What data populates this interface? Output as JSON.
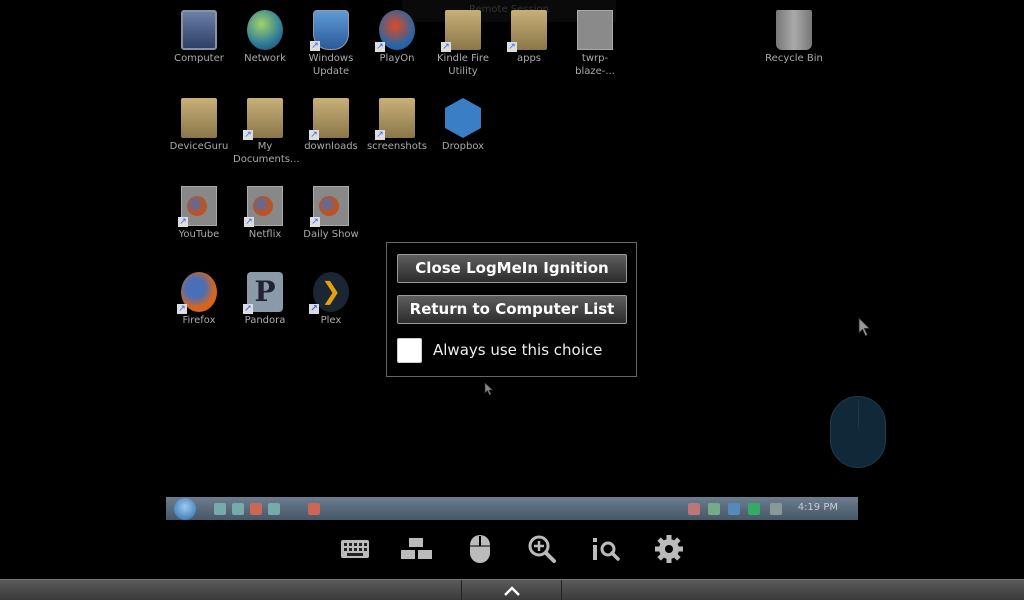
{
  "remote_session_label": "Remote Session",
  "desktop": {
    "icons": [
      {
        "label": "Computer"
      },
      {
        "label": "Network"
      },
      {
        "label": "Windows Update"
      },
      {
        "label": "PlayOn"
      },
      {
        "label": "Kindle Fire Utility"
      },
      {
        "label": "apps"
      },
      {
        "label": "twrp-blaze-..."
      },
      {
        "label": "Recycle Bin"
      },
      {
        "label": "DeviceGuru"
      },
      {
        "label": "My Documents..."
      },
      {
        "label": "downloads"
      },
      {
        "label": "screenshots"
      },
      {
        "label": "Dropbox"
      },
      {
        "label": "YouTube"
      },
      {
        "label": "Netflix"
      },
      {
        "label": "Daily Show"
      },
      {
        "label": "Firefox"
      },
      {
        "label": "Pandora"
      },
      {
        "label": "Plex"
      }
    ],
    "pandora_letter": "P",
    "plex_glyph": "❯"
  },
  "taskbar": {
    "clock": "4:19 PM"
  },
  "dialog": {
    "close_label": "Close LogMeIn Ignition",
    "return_label": "Return to Computer List",
    "always_label": "Always use this choice",
    "always_checked": false
  },
  "toolbar": {
    "tools": [
      "keyboard-icon",
      "screens-icon",
      "mouse-icon",
      "zoom-icon",
      "magnify-list-icon",
      "gear-icon"
    ]
  },
  "colors": {
    "background": "#000000",
    "dialog_border": "#666666",
    "button_gradient_top": "#5e5e5e"
  }
}
